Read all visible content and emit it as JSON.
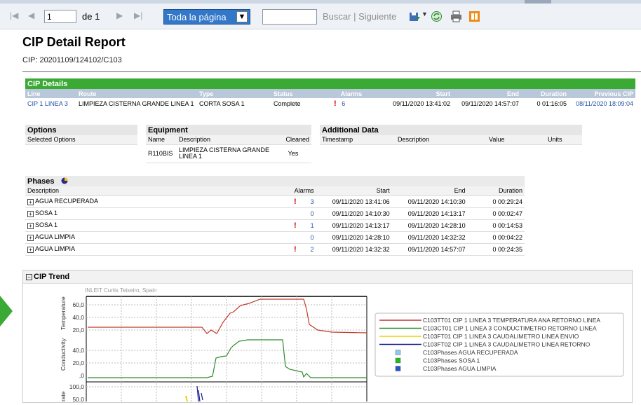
{
  "toolbar": {
    "page": "1",
    "of_label": "de 1",
    "zoom": "Toda la página",
    "find": "Buscar",
    "sep": "|",
    "next": "Siguiente"
  },
  "report": {
    "title": "CIP Detail Report",
    "cip": "CIP: 20201109/124102/C103"
  },
  "details": {
    "title": "CIP Details",
    "headers": [
      "Line",
      "Route",
      "Type",
      "Status",
      "Alarms",
      "Start",
      "End",
      "Duration",
      "Previous CIP"
    ],
    "row": {
      "line": "CIP 1 LINEA 3",
      "route": "LIMPIEZA CISTERNA GRANDE LINEA 1",
      "type": "CORTA SOSA 1",
      "status": "Complete",
      "alarms": "6",
      "start": "09/11/2020 13:41:02",
      "end": "09/11/2020 14:57:07",
      "duration": "0 01:16:05",
      "previous": "08/11/2020 18:09:04"
    }
  },
  "options": {
    "title": "Options",
    "col": "Selected Options"
  },
  "equipment": {
    "title": "Equipment",
    "headers": [
      "Name",
      "Description",
      "Cleaned"
    ],
    "row": {
      "name": "R110BIS",
      "desc": "LIMPIEZA CISTERNA GRANDE LINEA 1",
      "cleaned": "Yes"
    }
  },
  "additional": {
    "title": "Additional Data",
    "headers": [
      "Timestamp",
      "Description",
      "Value",
      "Units"
    ]
  },
  "phases": {
    "title": "Phases",
    "headers": [
      "Description",
      "Alarms",
      "Start",
      "End",
      "Duration"
    ],
    "rows": [
      {
        "desc": "AGUA RECUPERADA",
        "alarm": true,
        "alarms": "3",
        "start": "09/11/2020 13:41:06",
        "end": "09/11/2020 14:10:30",
        "dur": "0 00:29:24"
      },
      {
        "desc": "SOSA 1",
        "alarm": false,
        "alarms": "0",
        "start": "09/11/2020 14:10:30",
        "end": "09/11/2020 14:13:17",
        "dur": "0 00:02:47"
      },
      {
        "desc": "SOSA 1",
        "alarm": true,
        "alarms": "1",
        "start": "09/11/2020 14:13:17",
        "end": "09/11/2020 14:28:10",
        "dur": "0 00:14:53"
      },
      {
        "desc": "AGUA LIMPIA",
        "alarm": false,
        "alarms": "0",
        "start": "09/11/2020 14:28:10",
        "end": "09/11/2020 14:32:32",
        "dur": "0 00:04:22"
      },
      {
        "desc": "AGUA LIMPIA",
        "alarm": true,
        "alarms": "2",
        "start": "09/11/2020 14:32:32",
        "end": "09/11/2020 14:57:07",
        "dur": "0 00:24:35"
      }
    ]
  },
  "trend": {
    "title": "CIP Trend",
    "watermark": "INLEIT Curtis Teixeiro, Spain",
    "ylabel_temp": "Temperature",
    "ylabel_cond": "Conductivity",
    "ylabel_flow": "rate",
    "ticks_temp": [
      "60,0",
      "40,0",
      "20,0"
    ],
    "ticks_cond": [
      "40,0",
      "20,0",
      ",0"
    ],
    "ticks_flow": [
      "100,0",
      "50,0"
    ],
    "legend": [
      {
        "label": "C103TT01 CIP 1 LINEA 3 TEMPERATURA ANA RETORNO LINEA",
        "color": "#c0392b",
        "kind": "line"
      },
      {
        "label": "C103CT01 CIP 1 LINEA 3 CONDUCTIMETRO RETORNO LINEA",
        "color": "#2e8b2e",
        "kind": "line"
      },
      {
        "label": "C103FT01 CIP 1 LINEA 3 CAUDALIMETRO LINEA ENVIO",
        "color": "#f0d000",
        "kind": "line"
      },
      {
        "label": "C103FT02 CIP 1 LINEA 3 CAUDALIMETRO LINEA RETORNO",
        "color": "#1a1a8c",
        "kind": "line"
      },
      {
        "label": "C103Phases AGUA RECUPERADA",
        "color": "#8ec8ea",
        "kind": "box"
      },
      {
        "label": "C103Phases SOSA 1",
        "color": "#22bb22",
        "kind": "box"
      },
      {
        "label": "C103Phases AGUA LIMPIA",
        "color": "#2255cc",
        "kind": "box"
      }
    ]
  }
}
